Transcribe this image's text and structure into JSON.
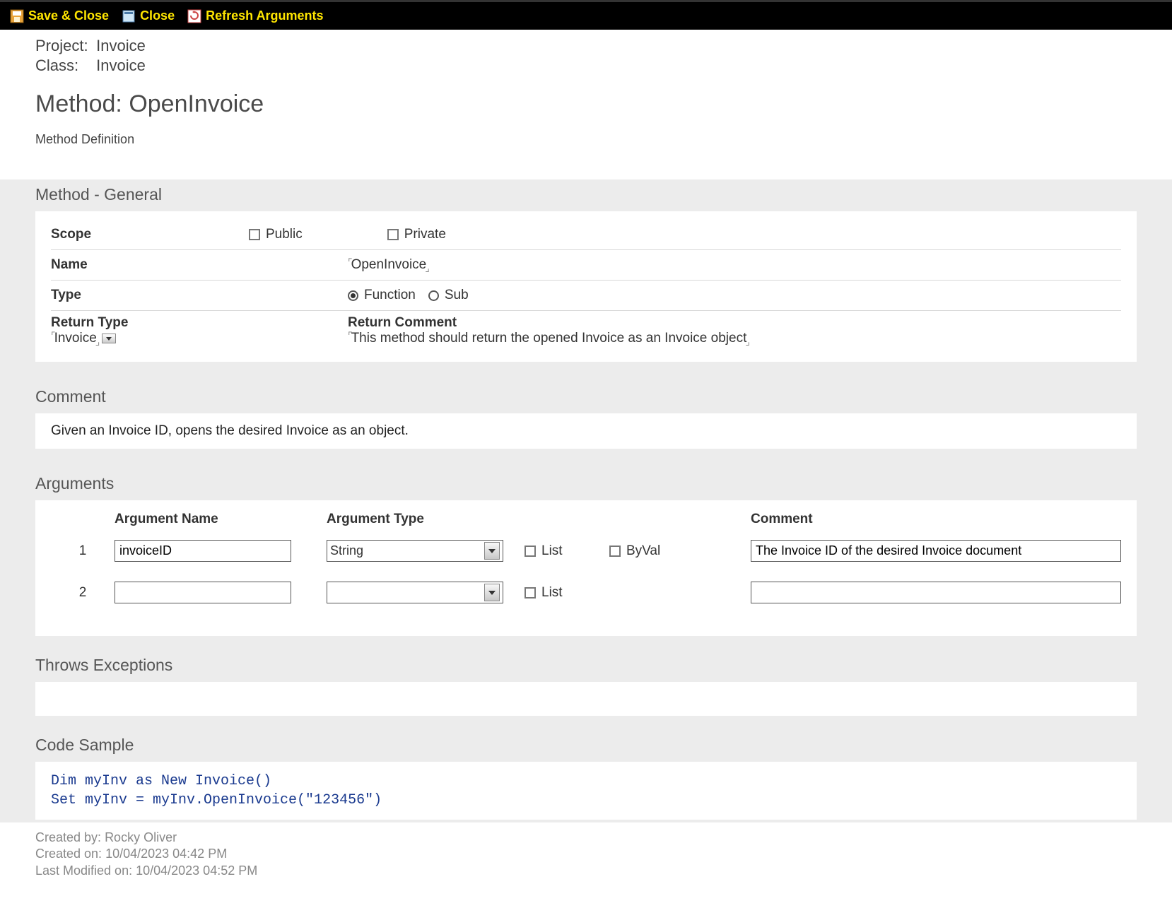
{
  "toolbar": {
    "save_close": "Save & Close",
    "close": "Close",
    "refresh_args": "Refresh Arguments"
  },
  "meta": {
    "project_label": "Project:",
    "project_value": "Invoice",
    "class_label": "Class:",
    "class_value": "Invoice"
  },
  "title_prefix": "Method: ",
  "title_value": "OpenInvoice",
  "method_definition_label": "Method Definition",
  "sections": {
    "general": "Method - General",
    "comment": "Comment",
    "arguments": "Arguments",
    "throws": "Throws Exceptions",
    "code": "Code Sample"
  },
  "general": {
    "scope_label": "Scope",
    "public_label": "Public",
    "private_label": "Private",
    "name_label": "Name",
    "name_value": "OpenInvoice",
    "type_label": "Type",
    "function_label": "Function",
    "sub_label": "Sub",
    "return_type_label": "Return Type",
    "return_type_value": "Invoice",
    "return_comment_label": "Return Comment",
    "return_comment_value": "This method should return the opened Invoice as an Invoice object"
  },
  "comment_text": "Given an Invoice ID, opens the desired Invoice as an object.",
  "args": {
    "col_idx": "",
    "col_name": "Argument Name",
    "col_type": "Argument Type",
    "col_list": "List",
    "col_byval": "ByVal",
    "col_comment": "Comment",
    "rows": [
      {
        "idx": "1",
        "name": "invoiceID",
        "type": "String",
        "list": false,
        "byval": false,
        "comment": "The Invoice ID of the desired Invoice document"
      },
      {
        "idx": "2",
        "name": "",
        "type": "",
        "list": false,
        "byval": null,
        "comment": ""
      }
    ]
  },
  "code_sample": "Dim myInv as New Invoice()\nSet myInv = myInv.OpenInvoice(\"123456\")",
  "footer": {
    "created_by_label": "Created by: ",
    "created_by": "Rocky Oliver",
    "created_on_label": "Created on: ",
    "created_on": "10/04/2023 04:42 PM",
    "modified_on_label": "Last Modified on: ",
    "modified_on": "10/04/2023 04:52 PM"
  }
}
